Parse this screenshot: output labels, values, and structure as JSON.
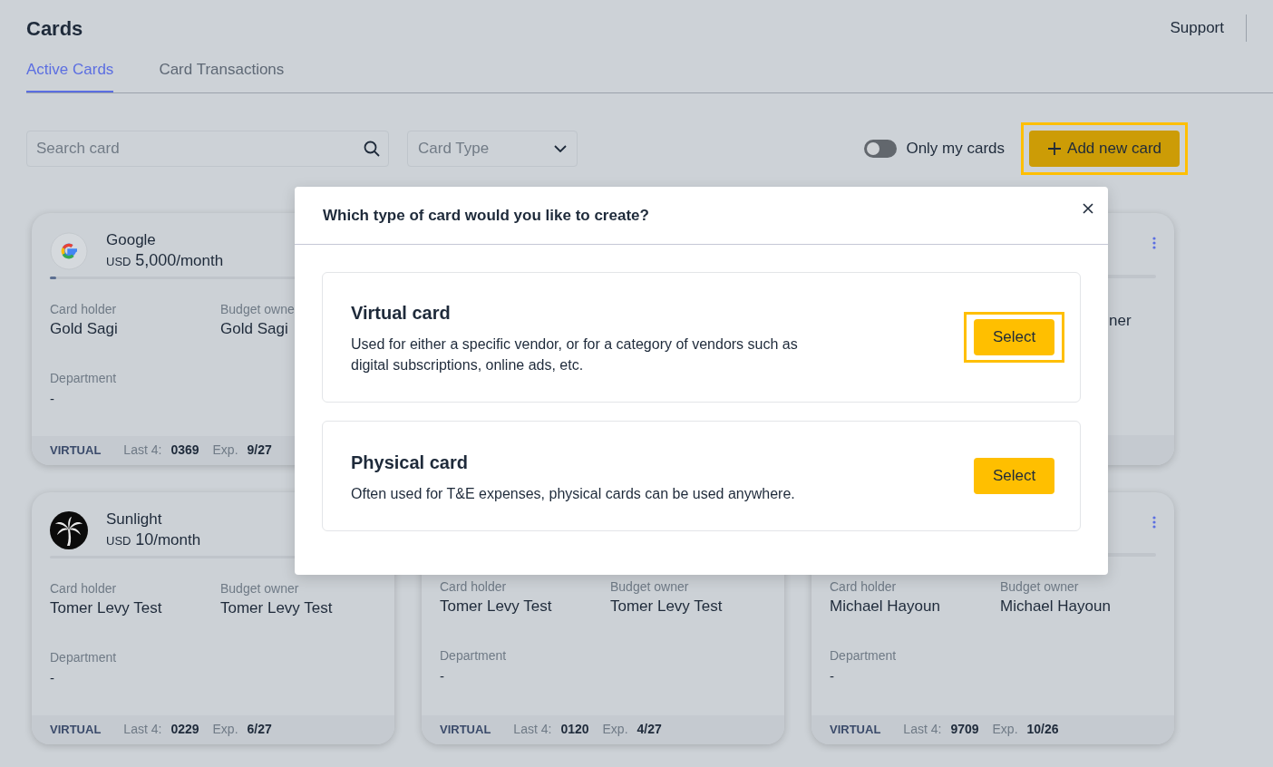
{
  "page": {
    "title": "Cards",
    "support_link": "Support"
  },
  "tabs": [
    {
      "label": "Active Cards",
      "selected": true
    },
    {
      "label": "Card Transactions",
      "selected": false
    }
  ],
  "search": {
    "placeholder": "Search card"
  },
  "card_type_filter": {
    "placeholder": "Card Type"
  },
  "only_my_cards": {
    "label": "Only my cards",
    "on": false
  },
  "add_button": {
    "label": "Add new card",
    "highlighted": true
  },
  "cards": [
    {
      "logo": {
        "kind": "google"
      },
      "name": "Google",
      "currency": "USD",
      "amount": "5,000",
      "period": "/month",
      "level": 0.02,
      "fields": [
        {
          "label": "Card holder",
          "value": "Gold Sagi"
        },
        {
          "label": "Budget owne",
          "value": "Gold Sagi"
        }
      ],
      "department": {
        "label": "Department",
        "value": "-"
      },
      "footer": {
        "type": "VIRTUAL",
        "last4_label": "Last 4:",
        "last4": "0369",
        "exp_label": "Exp.",
        "exp": "9/27"
      }
    },
    {
      "menu": true,
      "fields": [
        {
          "value": "ner",
          "clipped_left": true
        }
      ]
    },
    {
      "logo": {
        "kind": "palm"
      },
      "name": "Sunlight",
      "currency": "USD",
      "amount": "10",
      "period": "/month",
      "level": 0,
      "fields": [
        {
          "label": "Card holder",
          "value": "Tomer Levy Test"
        },
        {
          "label": "Budget owner",
          "value": "Tomer Levy Test"
        }
      ],
      "department": {
        "label": "Department",
        "value": "-"
      },
      "footer": {
        "type": "VIRTUAL",
        "last4_label": "Last 4:",
        "last4": "0229",
        "exp_label": "Exp.",
        "exp": "6/27"
      }
    },
    {
      "fields": [
        {
          "label": "Card holder",
          "value": "Tomer Levy Test"
        },
        {
          "label": "Budget owner",
          "value": "Tomer Levy Test"
        }
      ],
      "department": {
        "label": "Department",
        "value": "-"
      },
      "footer": {
        "type": "VIRTUAL",
        "last4_label": "Last 4:",
        "last4": "0120",
        "exp_label": "Exp.",
        "exp": "4/27"
      }
    },
    {
      "menu": true,
      "fields": [
        {
          "label": "Card holder",
          "value": "Michael Hayoun"
        },
        {
          "label": "Budget owner",
          "value": "Michael Hayoun"
        }
      ],
      "department": {
        "label": "Department",
        "value": "-"
      },
      "footer": {
        "type": "VIRTUAL",
        "last4_label": "Last 4:",
        "last4": "9709",
        "exp_label": "Exp.",
        "exp": "10/26"
      }
    }
  ],
  "dialog": {
    "title": "Which type of card would you like to create?",
    "options": [
      {
        "title": "Virtual card",
        "description": "Used for either a specific vendor, or for a category of vendors such as digital subscriptions, online ads, etc.",
        "button": "Select",
        "highlighted": true
      },
      {
        "title": "Physical card",
        "description": "Often used for T&E expenses, physical cards can be used anywhere.",
        "button": "Select",
        "highlighted": false
      }
    ]
  }
}
